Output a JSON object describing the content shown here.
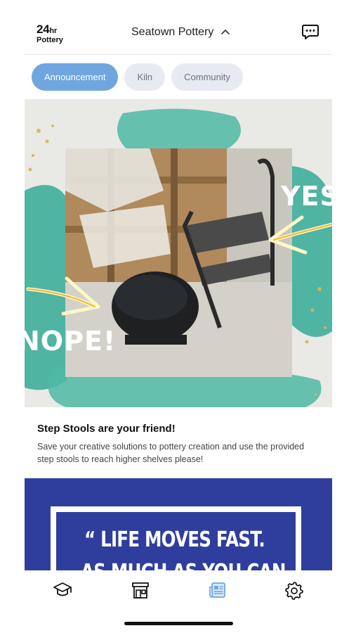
{
  "header": {
    "logo_main": "24",
    "logo_suffix": "hr",
    "logo_sub": "Pottery",
    "studio_name": "Seatown Pottery"
  },
  "tabs": [
    {
      "label": "Announcement",
      "active": true
    },
    {
      "label": "Kiln",
      "active": false
    },
    {
      "label": "Community",
      "active": false
    }
  ],
  "posts": [
    {
      "image_text_yes": "YES",
      "image_text_nope": "NOPE!",
      "title": "Step Stools are your friend!",
      "body": "Save your creative solutions to pottery creation and use the provided step stools to reach higher shelves please!"
    },
    {
      "quote_line1": "“ LIFE MOVES FAST.",
      "quote_line2": "AS MUCH AS YOU CAN"
    }
  ],
  "tabbar": {
    "items": [
      "graduation-cap-icon",
      "store-icon",
      "newspaper-icon",
      "gear-icon"
    ],
    "active_index": 2
  },
  "colors": {
    "accent": "#6fa6e0",
    "quote_bg": "#2f3e9c",
    "teal_paint": "#3fae9a"
  }
}
